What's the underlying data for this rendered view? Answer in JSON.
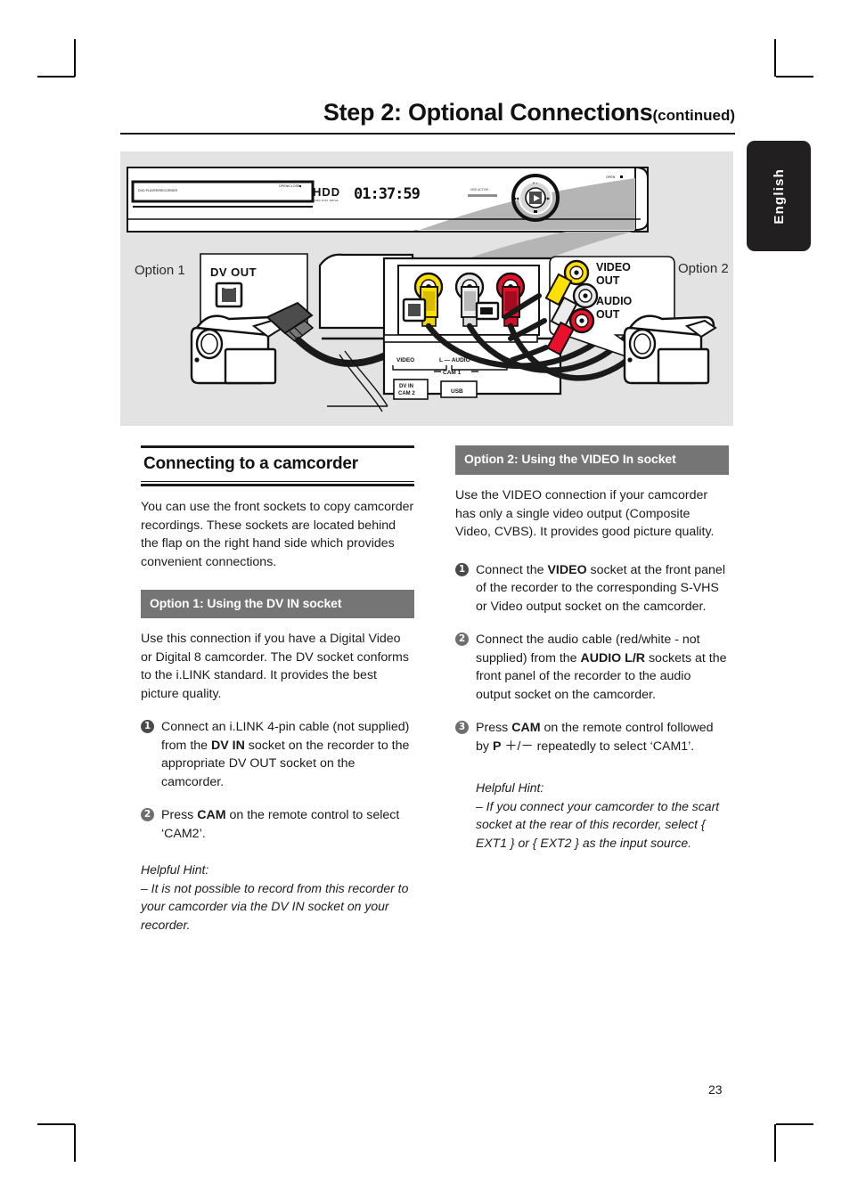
{
  "header": {
    "title": "Step 2: Optional Connections",
    "continued": "(continued)"
  },
  "language_tab": {
    "label": "English"
  },
  "figure": {
    "option1_label": "Option 1",
    "option2_label": "Option 2",
    "callout_dv_out": "DV OUT",
    "callout_video_out_line1": "VIDEO",
    "callout_video_out_line2": "OUT",
    "callout_audio_out_line1": "AUDIO",
    "callout_audio_out_line2": "OUT",
    "recorder": {
      "brand_text": "DVD PLAYER/RECORDER",
      "open_close": "OPEN/CLOSE",
      "hdd_logo": "HDD",
      "hdd_sub": "HARD DISK DRIVE",
      "display_time": "01:37:59",
      "hdd_active": "HDD ACTIVE",
      "open_label": "OPEN"
    },
    "front_sockets": {
      "video": "VIDEO",
      "audio": "L — AUDIO — R",
      "cam1": "CAM 1",
      "dv_in_line1": "DV IN",
      "dv_in_line2": "CAM 2",
      "usb": "USB"
    }
  },
  "left_column": {
    "section_title": "Connecting to a camcorder",
    "intro": "You can use the front sockets to copy camcorder recordings. These sockets are located behind the flap on the right hand side which provides convenient connections.",
    "option_bar": "Option 1: Using the DV IN socket",
    "option_intro": "Use this connection if you have a Digital Video or Digital 8 camcorder. The DV socket conforms to the i.LINK standard. It provides the best picture quality.",
    "steps": [
      {
        "num": "1",
        "pre": "Connect an i.LINK 4-pin cable (not supplied) from the ",
        "bold": "DV IN",
        "post": " socket on the recorder to the appropriate DV OUT socket on the camcorder."
      },
      {
        "num": "2",
        "pre": "Press ",
        "bold": "CAM",
        "post": " on the remote control to select ‘CAM2’."
      }
    ],
    "hint_title": "Helpful Hint:",
    "hint_body": "– It is not possible to record from this recorder to your camcorder via the DV IN socket on your recorder."
  },
  "right_column": {
    "option_bar": "Option 2: Using the VIDEO In socket",
    "option_intro": "Use the VIDEO connection if your camcorder has only a single video output (Composite Video, CVBS). It provides good picture quality.",
    "steps": [
      {
        "num": "1",
        "pre": "Connect the ",
        "bold": "VIDEO",
        "post": " socket at the front panel of the recorder to the corresponding S-VHS or Video output socket on the camcorder."
      },
      {
        "num": "2",
        "pre": "Connect the audio cable (red/white - not supplied) from the ",
        "bold": "AUDIO L/R",
        "post": " sockets at the front panel of the recorder to the audio output socket on the camcorder."
      },
      {
        "num": "3",
        "pre": "Press ",
        "bold": "CAM",
        "post": " on the remote control followed by ",
        "bold2": "P",
        "post2": " ＋/－ repeatedly to select ‘CAM1’."
      }
    ],
    "hint_title": "Helpful Hint:",
    "hint_body": "– If you connect your camcorder to the scart socket at the rear of this recorder, select { EXT1 } or { EXT2 } as the input source."
  },
  "footer": {
    "page_number": "23"
  },
  "colors": {
    "option_bar_bg": "#757575",
    "figure_bg": "#e3e3e3",
    "tab_bg": "#211f20",
    "cable_yellow": "#ffdd00",
    "cable_red": "#e8102a",
    "cable_white": "#e8e8e8",
    "cable_black": "#1a1a1a"
  }
}
